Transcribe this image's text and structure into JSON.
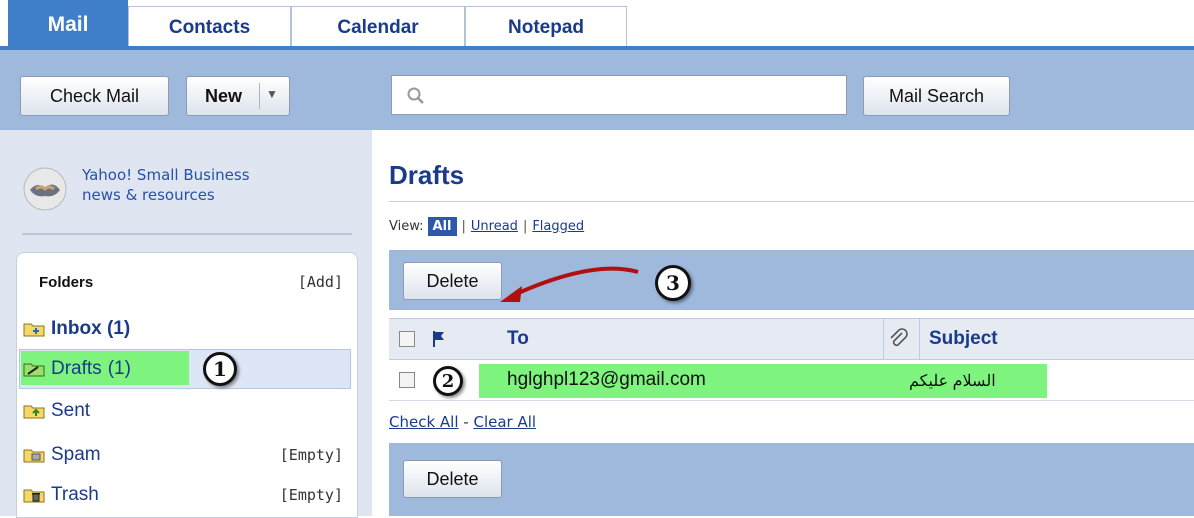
{
  "tabs": [
    {
      "label": "Mail"
    },
    {
      "label": "Contacts"
    },
    {
      "label": "Calendar"
    },
    {
      "label": "Notepad"
    }
  ],
  "toolbar": {
    "check_mail": "Check Mail",
    "new_label": "New",
    "search_value": "",
    "mail_search": "Mail Search"
  },
  "promo": {
    "line1": "Yahoo! Small Business",
    "line2": "news & resources"
  },
  "folders": {
    "title": "Folders",
    "add": "[Add]",
    "items": [
      {
        "label": "Inbox (1)",
        "icon": "inbox-folder-icon"
      },
      {
        "label": "Drafts",
        "count": "(1)",
        "icon": "drafts-folder-icon"
      },
      {
        "label": "Sent",
        "icon": "sent-folder-icon"
      },
      {
        "label": "Spam",
        "action": "[Empty]",
        "icon": "spam-folder-icon"
      },
      {
        "label": "Trash",
        "action": "[Empty]",
        "icon": "trash-folder-icon"
      }
    ]
  },
  "main": {
    "title": "Drafts",
    "view_label": "View:",
    "view_all": "All",
    "view_unread": "Unread",
    "view_flagged": "Flagged",
    "delete_label": "Delete",
    "col_to": "To",
    "col_subject": "Subject",
    "rows": [
      {
        "to": "hglghpl123@gmail.com",
        "subject": "السلام عليكم"
      }
    ],
    "check_all": "Check All",
    "clear_all": "Clear All"
  },
  "annotations": {
    "n1": "1",
    "n2": "2",
    "n3": "3"
  },
  "colors": {
    "tab_active": "#3f7fc9",
    "toolbar_bg": "#9fb9dd",
    "highlight": "#7ef47e",
    "arrow": "#b01010"
  }
}
